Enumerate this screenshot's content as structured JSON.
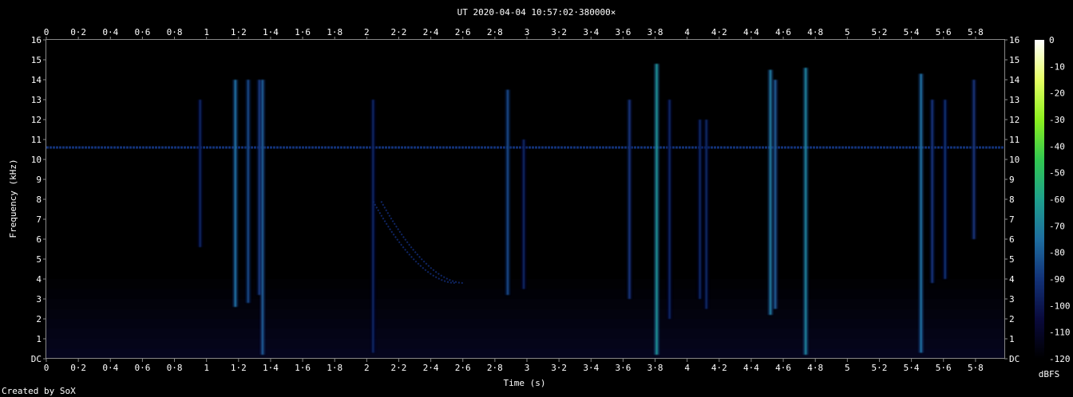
{
  "chart_data": {
    "type": "heatmap",
    "title": "UT 2020-04-04 10:57:02·380000×",
    "xlabel": "Time (s)",
    "ylabel": "Frequency (kHz)",
    "xlim": [
      0,
      5.98
    ],
    "ylim": [
      0,
      16
    ],
    "x_ticks": [
      "0",
      "0·2",
      "0·4",
      "0·6",
      "0·8",
      "1",
      "1·2",
      "1·4",
      "1·6",
      "1·8",
      "2",
      "2·2",
      "2·4",
      "2·6",
      "2·8",
      "3",
      "3·2",
      "3·4",
      "3·6",
      "3·8",
      "4",
      "4·2",
      "4·4",
      "4·6",
      "4·8",
      "5",
      "5·2",
      "5·4",
      "5·6",
      "5·8"
    ],
    "x_tick_values": [
      0,
      0.2,
      0.4,
      0.6,
      0.8,
      1,
      1.2,
      1.4,
      1.6,
      1.8,
      2,
      2.2,
      2.4,
      2.6,
      2.8,
      3,
      3.2,
      3.4,
      3.6,
      3.8,
      4,
      4.2,
      4.4,
      4.6,
      4.8,
      5,
      5.2,
      5.4,
      5.6,
      5.8
    ],
    "y_ticks": [
      "DC",
      "1",
      "2",
      "3",
      "4",
      "5",
      "6",
      "7",
      "8",
      "9",
      "10",
      "11",
      "12",
      "13",
      "14",
      "15",
      "16"
    ],
    "y_tick_values": [
      0,
      1,
      2,
      3,
      4,
      5,
      6,
      7,
      8,
      9,
      10,
      11,
      12,
      13,
      14,
      15,
      16
    ],
    "colorbar": {
      "label": "dBFS",
      "ticks": [
        "0",
        "-10",
        "-20",
        "-30",
        "-40",
        "-50",
        "-60",
        "-70",
        "-80",
        "-90",
        "-100",
        "-110",
        "-120"
      ],
      "range": [
        -120,
        0
      ],
      "colors": [
        "#000000",
        "#0a0a3c",
        "#123278",
        "#1e6ea0",
        "#1ea08c",
        "#32c850",
        "#8cf01e",
        "#e6ff64",
        "#ffffff"
      ]
    },
    "background_level_dbfs": -110,
    "tone": {
      "freq_khz": 10.6,
      "level_dbfs": -90
    },
    "vertical_events": [
      {
        "t": 0.96,
        "f_low": 5.6,
        "f_high": 13,
        "level": -95
      },
      {
        "t": 1.18,
        "f_low": 2.6,
        "f_high": 14,
        "level": -75
      },
      {
        "t": 1.26,
        "f_low": 2.8,
        "f_high": 14,
        "level": -85
      },
      {
        "t": 1.33,
        "f_low": 3.2,
        "f_high": 14,
        "level": -88
      },
      {
        "t": 1.35,
        "f_low": 0.2,
        "f_high": 14,
        "level": -80
      },
      {
        "t": 2.04,
        "f_low": 0.3,
        "f_high": 13,
        "level": -95
      },
      {
        "t": 2.88,
        "f_low": 3.2,
        "f_high": 13.5,
        "level": -85
      },
      {
        "t": 2.98,
        "f_low": 3.5,
        "f_high": 11,
        "level": -95
      },
      {
        "t": 3.64,
        "f_low": 3.0,
        "f_high": 13,
        "level": -90
      },
      {
        "t": 3.81,
        "f_low": 0.2,
        "f_high": 14.8,
        "level": -65
      },
      {
        "t": 3.89,
        "f_low": 2.0,
        "f_high": 13,
        "level": -95
      },
      {
        "t": 4.08,
        "f_low": 3.0,
        "f_high": 12,
        "level": -95
      },
      {
        "t": 4.12,
        "f_low": 2.5,
        "f_high": 12,
        "level": -95
      },
      {
        "t": 4.52,
        "f_low": 2.2,
        "f_high": 14.5,
        "level": -72
      },
      {
        "t": 4.55,
        "f_low": 2.5,
        "f_high": 14,
        "level": -80
      },
      {
        "t": 4.74,
        "f_low": 0.2,
        "f_high": 14.6,
        "level": -70
      },
      {
        "t": 5.46,
        "f_low": 0.3,
        "f_high": 14.3,
        "level": -75
      },
      {
        "t": 5.53,
        "f_low": 3.8,
        "f_high": 13,
        "level": -90
      },
      {
        "t": 5.61,
        "f_low": 4.0,
        "f_high": 13,
        "level": -92
      },
      {
        "t": 5.79,
        "f_low": 6.0,
        "f_high": 14,
        "level": -90
      }
    ],
    "sweep": {
      "t_start": 2.04,
      "f_start": 7.9,
      "t_end": 2.55,
      "f_end": 3.8,
      "level": -95
    },
    "grid": false
  },
  "footer": {
    "credit": "Created by SoX"
  }
}
